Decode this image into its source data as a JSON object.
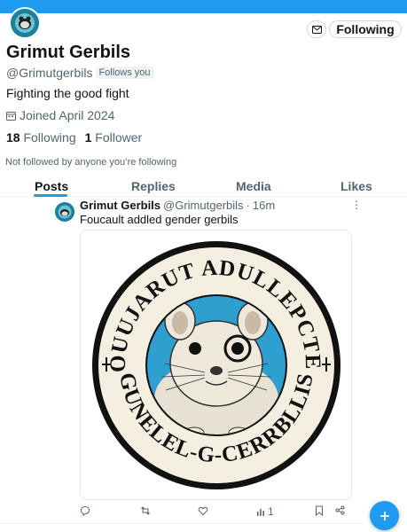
{
  "profile": {
    "name": "Grimut Gerbils",
    "handle": "@Grimutgerbils",
    "follows_you": "Follows you",
    "bio": "Fighting the good fight",
    "joined": "Joined April 2024",
    "following_count": "18",
    "following_label": "Following",
    "followers_count": "1",
    "followers_label": "Follower",
    "not_followed": "Not followed by anyone you’re following",
    "avatar_text": "GRIMUT GERBILS"
  },
  "header": {
    "follow_button": "Following"
  },
  "tabs": [
    {
      "label": "Posts",
      "active": true
    },
    {
      "label": "Replies",
      "active": false
    },
    {
      "label": "Media",
      "active": false
    },
    {
      "label": "Likes",
      "active": false
    }
  ],
  "post": {
    "name": "Grimut Gerbils",
    "handle": "@Grimutgerbils",
    "dot": "·",
    "time": "16m",
    "more": "⋮",
    "text": "Foucault addled gender gerbils",
    "image": {
      "top_arc": "FOUUJARUT ADULLEPCTER",
      "bottom_arc": "GUNELEL-G-CERRBLLIS"
    },
    "views": "1"
  },
  "colors": {
    "accent": "#1d9bf0",
    "secondary_text": "#536471",
    "emblem_blue": "#2f9fd0"
  },
  "icons": {
    "message": "envelope-icon",
    "calendar": "calendar-icon",
    "reply": "reply-icon",
    "repost": "repost-icon",
    "like": "heart-icon",
    "views": "bar-chart-icon",
    "bookmark": "bookmark-icon",
    "share": "share-icon",
    "compose": "plus-icon"
  }
}
